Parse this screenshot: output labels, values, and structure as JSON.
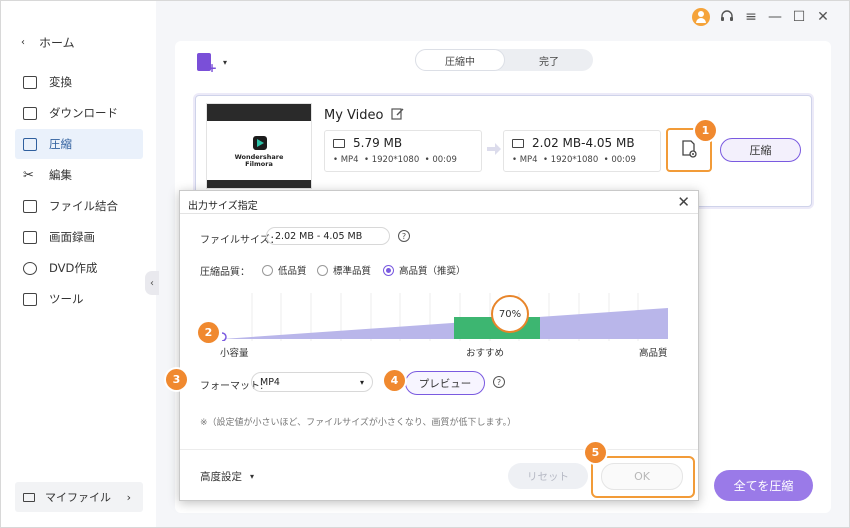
{
  "window": {
    "controls": [
      "?",
      "≡",
      "—",
      "☐",
      "✕"
    ]
  },
  "sidebar": {
    "back_label": "ホーム",
    "items": [
      {
        "label": "変換",
        "icon": "convert-icon"
      },
      {
        "label": "ダウンロード",
        "icon": "download-icon"
      },
      {
        "label": "圧縮",
        "icon": "compress-icon",
        "active": true
      },
      {
        "label": "編集",
        "icon": "scissors-icon"
      },
      {
        "label": "ファイル結合",
        "icon": "merge-icon"
      },
      {
        "label": "画面録画",
        "icon": "screen-record-icon"
      },
      {
        "label": "DVD作成",
        "icon": "dvd-icon"
      },
      {
        "label": "ツール",
        "icon": "toolbox-icon"
      }
    ],
    "my_files_label": "マイファイル"
  },
  "main": {
    "tabs": [
      {
        "label": "圧縮中",
        "active": true
      },
      {
        "label": "完了",
        "active": false
      }
    ],
    "file": {
      "title": "My Video",
      "thumb_brand_line1": "Wondershare",
      "thumb_brand_line2": "Filmora",
      "source": {
        "size": "5.79 MB",
        "format": "MP4",
        "resolution": "1920*1080",
        "duration": "00:09"
      },
      "target": {
        "size": "2.02 MB-4.05 MB",
        "format": "MP4",
        "resolution": "1920*1080",
        "duration": "00:09"
      },
      "compress_label": "圧縮"
    },
    "compress_all_label": "全てを圧縮"
  },
  "dialog": {
    "title": "出力サイズ指定",
    "file_size_label": "ファイルサイズ：",
    "file_size_value": "2.02 MB - 4.05 MB",
    "quality_label": "圧縮品質：",
    "quality_options": [
      {
        "label": "低品質",
        "selected": false
      },
      {
        "label": "標準品質",
        "selected": false
      },
      {
        "label": "高品質（推奨）",
        "selected": true
      }
    ],
    "slider": {
      "value_label": "70%",
      "value": 0.7,
      "min_label": "小容量",
      "mid_label": "おすすめ",
      "max_label": "高品質"
    },
    "format_label": "フォーマット:",
    "format_value": "MP4",
    "preview_label": "プレビュー",
    "note": "※（設定値が小さいほど、ファイルサイズが小さくなり、画質が低下します。）",
    "advanced_label": "高度設定",
    "reset_label": "リセット",
    "ok_label": "OK"
  },
  "steps": [
    "1",
    "2",
    "3",
    "4",
    "5"
  ],
  "colors": {
    "accent": "#7a5ae0",
    "highlight": "#f29b38",
    "step_badge": "#f0892f",
    "recommended_band": "#3db671",
    "track": "#b9b6ea"
  }
}
